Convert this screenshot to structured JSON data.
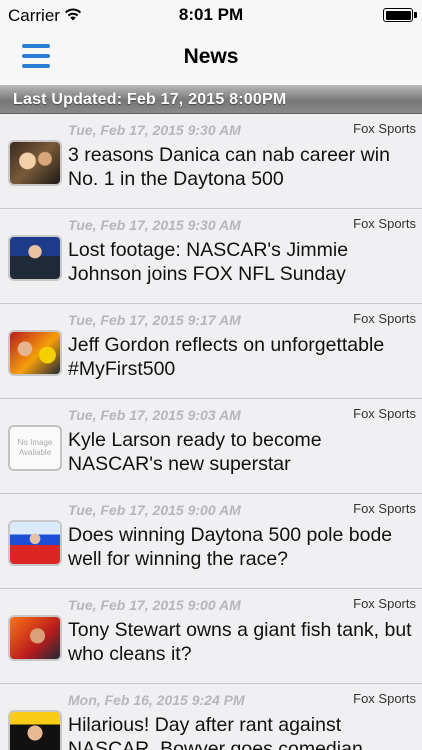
{
  "status": {
    "carrier": "Carrier",
    "time": "8:01 PM"
  },
  "nav": {
    "title": "News"
  },
  "updated": "Last Updated: Feb 17, 2015 8:00PM",
  "no_image_text": "No Image Available",
  "items": [
    {
      "date": "Tue, Feb 17, 2015 9:30 AM",
      "source": "Fox Sports",
      "headline": "3 reasons Danica can nab career win No. 1 in the Daytona 500"
    },
    {
      "date": "Tue, Feb 17, 2015 9:30 AM",
      "source": "Fox Sports",
      "headline": "Lost footage: NASCAR's Jimmie Johnson joins FOX NFL Sunday"
    },
    {
      "date": "Tue, Feb 17, 2015 9:17 AM",
      "source": "Fox Sports",
      "headline": "Jeff Gordon reflects on unforgettable #MyFirst500"
    },
    {
      "date": "Tue, Feb 17, 2015 9:03 AM",
      "source": "Fox Sports",
      "headline": "Kyle Larson ready to become NASCAR's new superstar"
    },
    {
      "date": "Tue, Feb 17, 2015 9:00 AM",
      "source": "Fox Sports",
      "headline": "Does winning Daytona 500 pole bode well for winning the race?"
    },
    {
      "date": "Tue, Feb 17, 2015 9:00 AM",
      "source": "Fox Sports",
      "headline": "Tony Stewart owns a giant fish tank, but who cleans it?"
    },
    {
      "date": "Mon, Feb 16, 2015 9:24 PM",
      "source": "Fox Sports",
      "headline": "Hilarious! Day after rant against NASCAR, Bowyer goes comedian"
    }
  ]
}
